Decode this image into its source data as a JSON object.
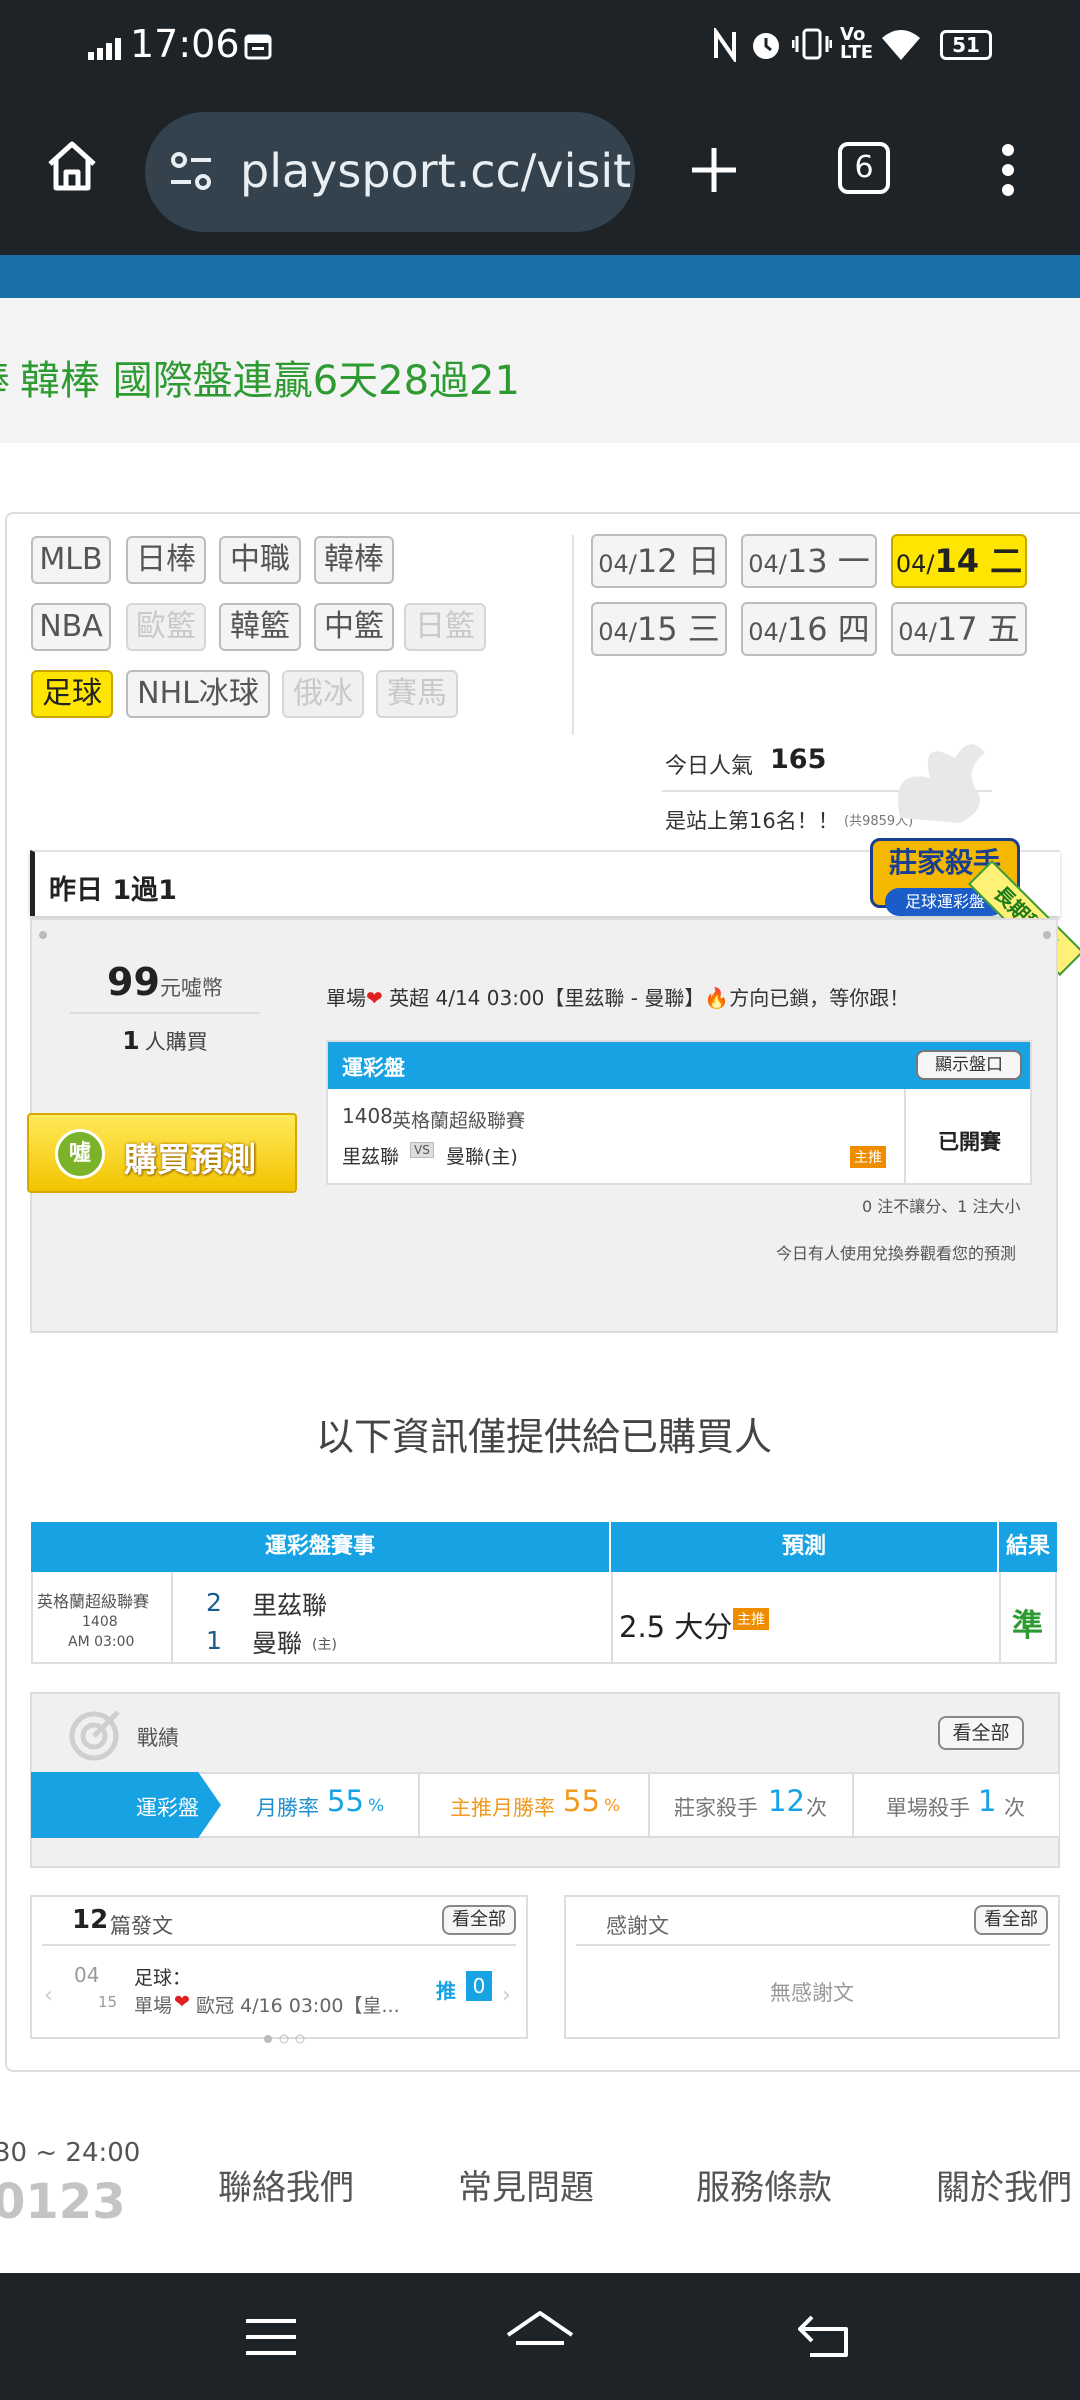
{
  "status_bar": {
    "time": "17:06",
    "battery": "51",
    "icons": [
      "signal-icon",
      "calendar-icon",
      "nfc-icon",
      "alarm-icon",
      "vibrate-icon",
      "volte-icon",
      "wifi-icon",
      "battery-icon"
    ]
  },
  "browser": {
    "url": "playsport.cc/visit",
    "tab_count": "6"
  },
  "ticker": {
    "text": "韓棒 國際盤連贏6天28過21",
    "lead": "棒"
  },
  "league_tags": [
    {
      "label": "MLB",
      "state": "normal"
    },
    {
      "label": "日棒",
      "state": "normal"
    },
    {
      "label": "中職",
      "state": "normal"
    },
    {
      "label": "韓棒",
      "state": "normal"
    },
    {
      "label": "NBA",
      "state": "normal"
    },
    {
      "label": "歐籃",
      "state": "disabled"
    },
    {
      "label": "韓籃",
      "state": "normal"
    },
    {
      "label": "中籃",
      "state": "normal"
    },
    {
      "label": "日籃",
      "state": "disabled"
    },
    {
      "label": "足球",
      "state": "selected"
    },
    {
      "label": "NHL冰球",
      "state": "normal"
    },
    {
      "label": "俄冰",
      "state": "disabled"
    },
    {
      "label": "賽馬",
      "state": "disabled"
    }
  ],
  "dates": [
    {
      "md": "04/",
      "d": "12 日"
    },
    {
      "md": "04/",
      "d": "13 一"
    },
    {
      "md": "04/",
      "d": "14 二",
      "selected": true
    },
    {
      "md": "04/",
      "d": "15 三"
    },
    {
      "md": "04/",
      "d": "16 四"
    },
    {
      "md": "04/",
      "d": "17 五"
    }
  ],
  "popularity": {
    "label": "今日人氣",
    "value": "165",
    "rank_text": "是站上第16名！！",
    "total": "(共9859人)"
  },
  "badge": {
    "main": "莊家殺手",
    "sub": "足球運彩盤",
    "ribbon": "長期穩定"
  },
  "record": {
    "title": "昨日 1過1"
  },
  "price": {
    "amount": "99",
    "unit": "元噓幣",
    "buyers_count": "1",
    "buyers_label": "人購買",
    "buy_button": "購買預測",
    "buy_icon": "噓"
  },
  "pick_note": {
    "prefix": "單場",
    "text": "英超 4/14 03:00【里茲聯 - 曼聯】",
    "suffix": "方向已鎖，等你跟！"
  },
  "game_box": {
    "header": "運彩盤",
    "toggle_button": "顯示盤口",
    "game_no": "1408",
    "league": "英格蘭超級聯賽",
    "away": "里茲聯",
    "vs": "VS",
    "home": "曼聯(主)",
    "tag": "主推",
    "status": "已開賽"
  },
  "pick_stats": "0 注不讓分、1 注大小",
  "voucher_note": "今日有人使用兌換券觀看您的預測",
  "buyers_only": "以下資訊僅提供給已購買人",
  "result_table": {
    "headers": [
      "運彩盤賽事",
      "預測",
      "結果"
    ],
    "league": "英格蘭超級聯賽",
    "game_no": "1408",
    "time": "AM 03:00",
    "away_score": "2",
    "away": "里茲聯",
    "home_score": "1",
    "home": "曼聯",
    "home_mark": "(主)",
    "prediction": "2.5 大分",
    "prediction_tag": "主推",
    "result": "準"
  },
  "stats": {
    "title": "戰績",
    "view_all": "看全部",
    "tab": "運彩盤",
    "month_label": "月勝率",
    "month_value": "55",
    "month_unit": "%",
    "main_label": "主推月勝率",
    "main_value": "55",
    "main_unit": "%",
    "killer_label": "莊家殺手",
    "killer_value": "12",
    "killer_unit": "次",
    "single_label": "單場殺手",
    "single_value": "1",
    "single_unit": "次"
  },
  "posts": {
    "count": "12",
    "label": "篇發文",
    "view_all": "看全部",
    "date_m": "04",
    "date_d": "15",
    "category": "足球：",
    "title": "單場",
    "title_rest": "歐冠 4/16 03:00【皇...",
    "push_label": "推",
    "push_count": "0"
  },
  "thanks": {
    "label": "感謝文",
    "view_all": "看全部",
    "empty": "無感謝文"
  },
  "footer": {
    "hours": "30 ~ 24:00",
    "phone": "0123",
    "links": [
      "聯絡我們",
      "常見問題",
      "服務條款",
      "關於我們"
    ]
  },
  "colors": {
    "accent_blue": "#17a2e4",
    "green": "#2d9a32",
    "orange": "#f08c00",
    "selected_yellow": "#ffe600"
  }
}
